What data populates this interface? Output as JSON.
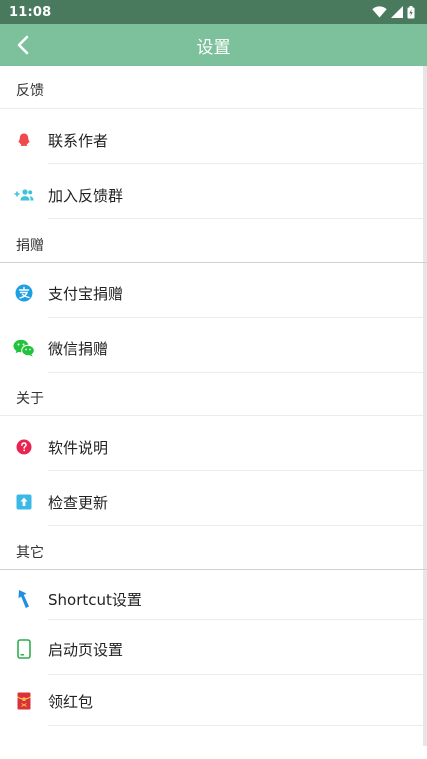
{
  "status_bar": {
    "time": "11:08"
  },
  "app_bar": {
    "title": "设置"
  },
  "sections": {
    "feedback": {
      "header": "反馈",
      "items": [
        {
          "label": "联系作者",
          "icon": "qq-icon"
        },
        {
          "label": "加入反馈群",
          "icon": "add-group-icon"
        }
      ]
    },
    "donate": {
      "header": "捐赠",
      "items": [
        {
          "label": "支付宝捐赠",
          "icon": "alipay-icon"
        },
        {
          "label": "微信捐赠",
          "icon": "wechat-icon"
        }
      ]
    },
    "about": {
      "header": "关于",
      "items": [
        {
          "label": "软件说明",
          "icon": "help-icon"
        },
        {
          "label": "检查更新",
          "icon": "update-icon"
        }
      ]
    },
    "other": {
      "header": "其它",
      "items": [
        {
          "label": "Shortcut设置",
          "icon": "shortcut-icon"
        },
        {
          "label": "启动页设置",
          "icon": "phone-icon"
        },
        {
          "label": "领红包",
          "icon": "red-packet-icon"
        }
      ]
    }
  },
  "colors": {
    "status_bar": "#4a7a5e",
    "app_bar": "#7cc19b",
    "qq": "#f0484b",
    "group": "#3ec3d8",
    "alipay": "#1e9fe3",
    "wechat": "#22c23c",
    "help": "#e8244f",
    "update": "#3bb9e6",
    "shortcut": "#1f8fe0",
    "phone": "#2fae4e",
    "red_packet": "#d9323a"
  }
}
